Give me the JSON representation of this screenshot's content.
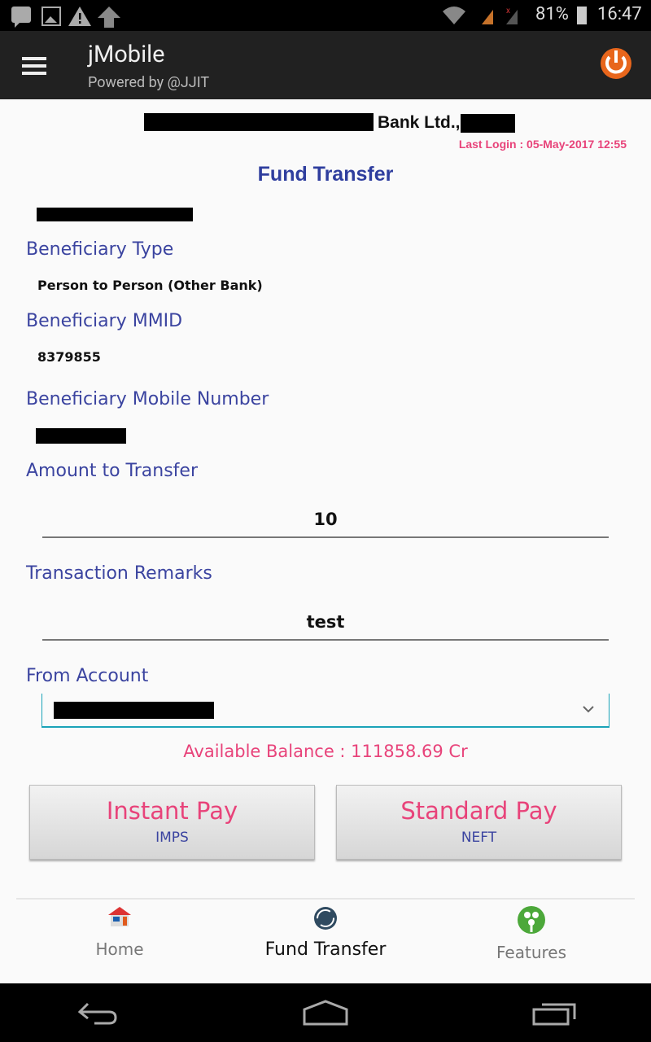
{
  "status_bar": {
    "battery": "81%",
    "time": "16:47",
    "icons": [
      "messenger-icon",
      "image-icon",
      "warning-icon",
      "upload-icon",
      "wifi-icon",
      "signal-icon",
      "signal-no-sim-icon",
      "battery-icon"
    ]
  },
  "app_bar": {
    "title": "jMobile",
    "subtitle": "Powered by @JJIT",
    "menu_icon": "hamburger-icon",
    "power_icon": "power-icon"
  },
  "header": {
    "bank_name": "Bank Ltd.,",
    "last_login": "Last Login : 05-May-2017 12:55"
  },
  "page_title": "Fund Transfer",
  "form": {
    "beneficiary_type_label": "Beneficiary Type",
    "beneficiary_type": "Person to Person (Other Bank)",
    "mmid_label": "Beneficiary MMID",
    "mmid": "8379855",
    "mobile_label": "Beneficiary Mobile Number",
    "amount_label": "Amount to Transfer",
    "amount": "10",
    "remarks_label": "Transaction Remarks",
    "remarks": "test",
    "from_account_label": "From Account",
    "available_balance": "Available Balance : 111858.69 Cr"
  },
  "buttons": {
    "instant": {
      "title": "Instant Pay",
      "sub": "IMPS"
    },
    "standard": {
      "title": "Standard Pay",
      "sub": "NEFT"
    }
  },
  "bottom_nav": [
    {
      "label": "Home",
      "icon": "home-icon"
    },
    {
      "label": "Fund Transfer",
      "icon": "transfer-icon",
      "active": true
    },
    {
      "label": "Features",
      "icon": "features-icon"
    }
  ],
  "colors": {
    "accent": "#e8437a",
    "label": "#3b44a0",
    "appbar": "#212121",
    "power": "#e8661c"
  }
}
